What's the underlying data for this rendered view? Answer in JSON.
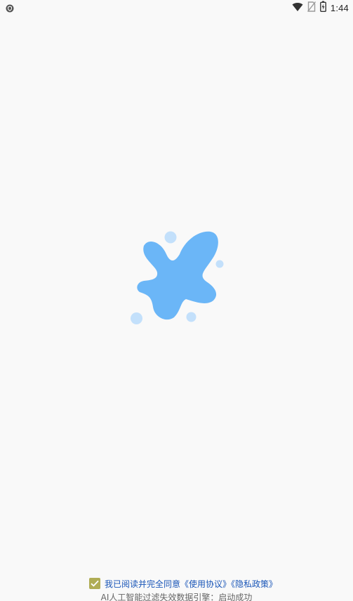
{
  "status_bar": {
    "time": "1:44",
    "icons": [
      "shield-icon",
      "wifi-icon",
      "no-sim-icon",
      "battery-icon"
    ]
  },
  "splash": {
    "logo_icon": "splash-blob-icon",
    "logo_color": "#6bb6f7",
    "bubble_color": "#c3e0fb"
  },
  "agreement": {
    "checked": true,
    "prefix": "我已阅读并完全同意",
    "user_agreement": "《使用协议》",
    "privacy_policy": "《隐私政策》"
  },
  "engine_status": "AI人工智能过滤失效数据引擎：启动成功"
}
